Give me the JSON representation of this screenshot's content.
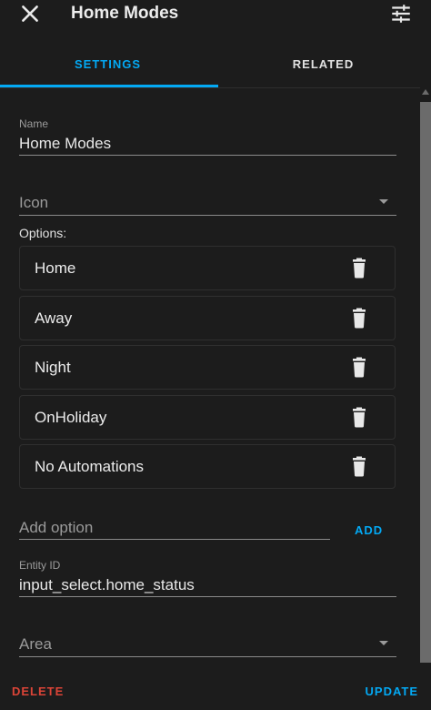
{
  "header": {
    "title": "Home Modes"
  },
  "tabs": [
    {
      "label": "SETTINGS"
    },
    {
      "label": "RELATED"
    }
  ],
  "form": {
    "name_label": "Name",
    "name_value": "Home Modes",
    "icon_placeholder": "Icon",
    "options_label": "Options:",
    "options": [
      {
        "label": "Home"
      },
      {
        "label": "Away"
      },
      {
        "label": "Night"
      },
      {
        "label": "OnHoliday"
      },
      {
        "label": "No Automations"
      }
    ],
    "add_option_placeholder": "Add option",
    "add_label": "ADD",
    "entity_id_label": "Entity ID",
    "entity_id_value": "input_select.home_status",
    "area_placeholder": "Area"
  },
  "footer": {
    "delete_label": "DELETE",
    "update_label": "UPDATE"
  },
  "colors": {
    "accent": "#03a9f4",
    "danger": "#db4437",
    "background": "#1c1c1c"
  }
}
